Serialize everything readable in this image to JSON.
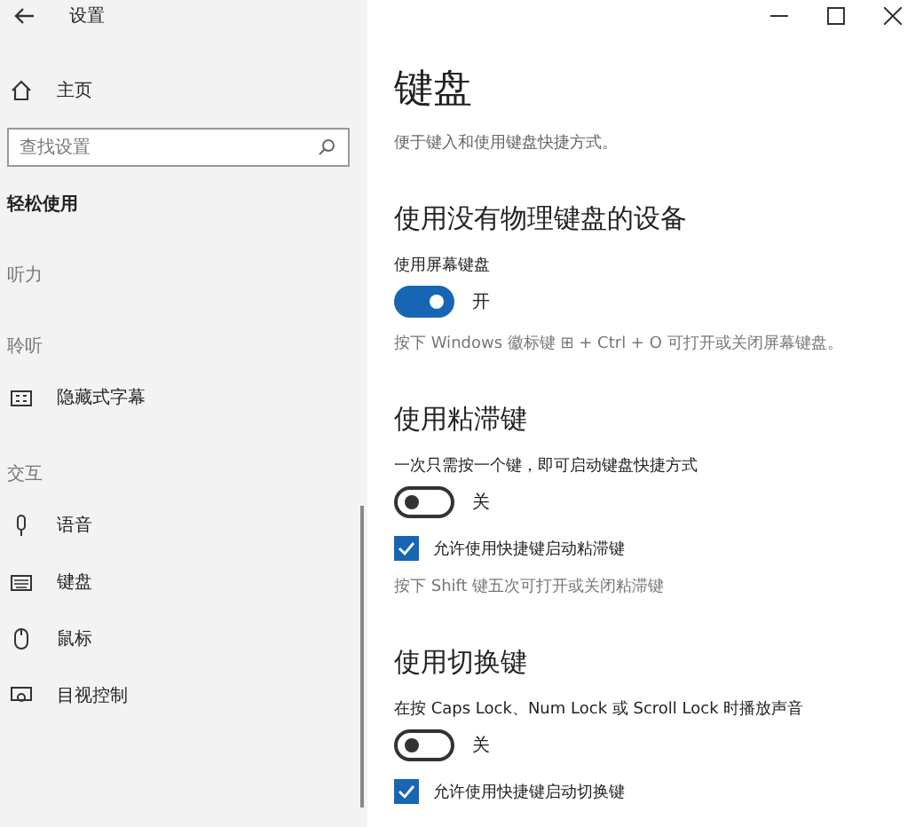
{
  "window": {
    "title": "设置"
  },
  "sidebar": {
    "home": "主页",
    "search": {
      "placeholder": "查找设置"
    },
    "category": "轻松使用",
    "groups": [
      {
        "heading": "听力"
      },
      {
        "heading": "聆听",
        "items": [
          {
            "label": "隐藏式字幕",
            "kind": "captions"
          }
        ]
      },
      {
        "heading": "交互",
        "items": [
          {
            "label": "语音",
            "kind": "microphone"
          },
          {
            "label": "键盘",
            "kind": "keyboard"
          },
          {
            "label": "鼠标",
            "kind": "mouse"
          },
          {
            "label": "目视控制",
            "kind": "monitor"
          }
        ]
      }
    ]
  },
  "page": {
    "title": "键盘",
    "description": "便于键入和使用键盘快捷方式。",
    "sections": [
      {
        "heading": "使用没有物理键盘的设备",
        "items": [
          {
            "kind": "toggle",
            "label": "使用屏幕键盘",
            "on": true,
            "state_text": "开"
          },
          {
            "kind": "note",
            "text": "按下 Windows 徽标键 ⊞ + Ctrl + O 可打开或关闭屏幕键盘。"
          }
        ]
      },
      {
        "heading": "使用粘滞键",
        "items": [
          {
            "kind": "toggle",
            "label": "一次只需按一个键，即可启动键盘快捷方式",
            "on": false,
            "state_text": "关"
          },
          {
            "kind": "checkbox",
            "label": "允许使用快捷键启动粘滞键",
            "checked": true
          },
          {
            "kind": "note",
            "text": "按下 Shift 键五次可打开或关闭粘滞键"
          }
        ]
      },
      {
        "heading": "使用切换键",
        "items": [
          {
            "kind": "toggle",
            "label": "在按 Caps Lock、Num Lock 或 Scroll Lock 时播放声音",
            "on": false,
            "state_text": "关"
          },
          {
            "kind": "checkbox",
            "label": "允许使用快捷键启动切换键",
            "checked": true
          }
        ]
      }
    ]
  }
}
